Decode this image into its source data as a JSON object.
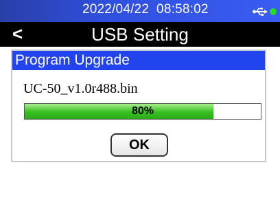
{
  "status_bar": {
    "datetime": "2022/04/22  08:58:02",
    "usb_icon": "usb-icon",
    "connection_indicator_color": "#22dd22",
    "background_color": "#3050e0"
  },
  "title_bar": {
    "back_label": "<",
    "title": "USB Setting"
  },
  "dialog": {
    "header": "Program Upgrade",
    "header_color": "#2244ee",
    "file_name": "UC-50_v1.0r488.bin",
    "progress": {
      "percent": 80,
      "label": "80%",
      "fill_color": "#38c020"
    },
    "ok_label": "OK"
  }
}
